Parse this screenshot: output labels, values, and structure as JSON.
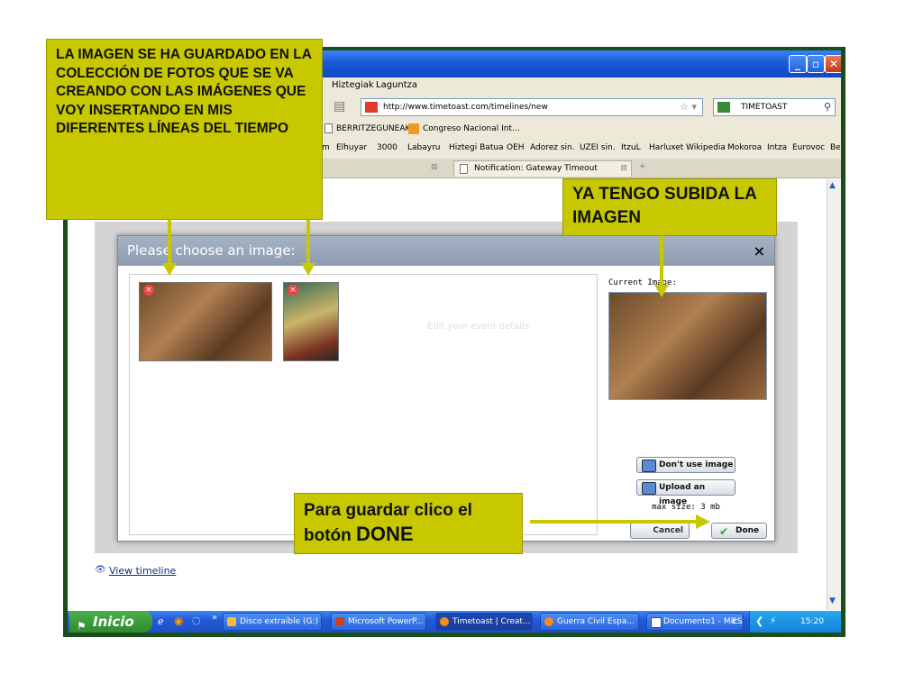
{
  "browser": {
    "menu": [
      "Hiztegiak",
      "Laguntza"
    ],
    "url": "http://www.timetoast.com/timelines/new",
    "search": "TIMETOAST",
    "bookmarks": [
      "BERRITZEGUNEAK",
      "Congreso Nacional Int..."
    ],
    "links": [
      "m",
      "Elhuyar",
      "3000",
      "Labayru",
      "Hiztegi Batua",
      "OEH",
      "Adorez sin.",
      "UZEI sin.",
      "ItzuL",
      "Harluxet",
      "Wikipedia",
      "Mokoroa",
      "Intza",
      "Eurovoc",
      "Be"
    ],
    "tab2": "Notification: Gateway Timeout"
  },
  "modal": {
    "title": "Please choose an image:",
    "close": "×",
    "current_label": "Current Image:",
    "dont_use": "Don't use image",
    "upload": "Upload an image",
    "max_size": "max size: 3 mb",
    "cancel": "Cancel",
    "done": "Done",
    "ghost_heading": "Edit your event details"
  },
  "page": {
    "view_timeline": "View timeline"
  },
  "taskbar": {
    "start": "Inicio",
    "tasks": [
      "Disco extraíble (G:)",
      "Microsoft PowerP...",
      "Timetoast | Creat...",
      "Guerra Civil Espa...",
      "Documento1 - Mic..."
    ],
    "lang": "ES",
    "clock": "15:20"
  },
  "callouts": {
    "saved": "LA IMAGEN SE  HA GUARDADO EN LA COLECCIÓN DE FOTOS QUE SE VA CREANDO CON LAS IMÁGENES QUE VOY INSERTANDO EN MIS DIFERENTES LÍNEAS DEL TIEMPO",
    "uploaded": "YA TENGO SUBIDA LA IMAGEN",
    "save_instr": "Para guardar clico el botón",
    "save_done": "DONE"
  },
  "colors": {
    "callout": "#c8c800",
    "xp_blue": "#245ad6",
    "start_green": "#2e8a2e"
  }
}
